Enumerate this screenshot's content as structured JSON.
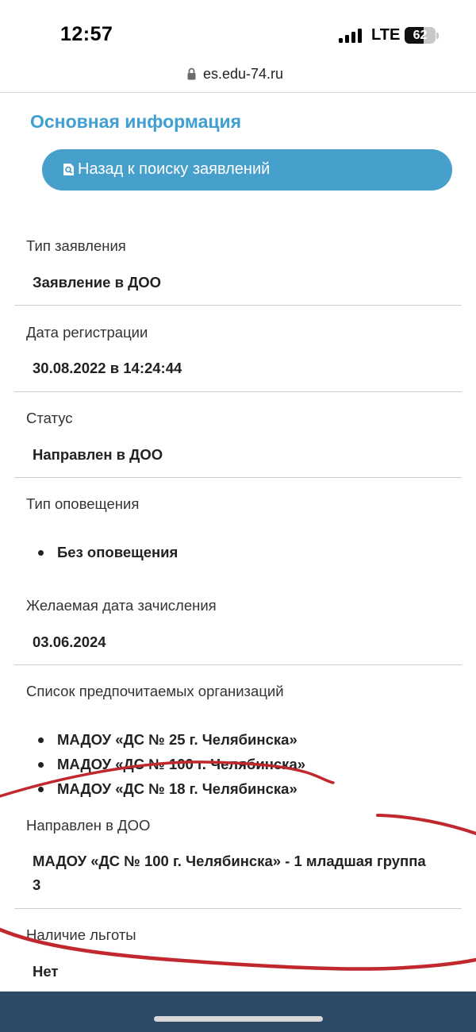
{
  "status_bar": {
    "time": "12:57",
    "network": "LTE",
    "battery": "62",
    "battery_level": 0.62
  },
  "browser": {
    "url": "es.edu-74.ru"
  },
  "page": {
    "section_title": "Основная информация",
    "back_button_label": "Назад к поиску заявлений"
  },
  "fields": {
    "application_type": {
      "label": "Тип заявления",
      "value": "Заявление в ДОО"
    },
    "registration_date": {
      "label": "Дата регистрации",
      "value": "30.08.2022 в 14:24:44"
    },
    "status": {
      "label": "Статус",
      "value": "Направлен в ДОО"
    },
    "notification_type": {
      "label": "Тип оповещения",
      "items": [
        "Без оповещения"
      ]
    },
    "desired_enrollment_date": {
      "label": "Желаемая дата зачисления",
      "value": "03.06.2024"
    },
    "preferred_organizations": {
      "label": "Список предпочитаемых организаций",
      "items": [
        "МАДОУ «ДС № 25 г. Челябинска»",
        "МАДОУ «ДС № 100 г. Челябинска»",
        "МАДОУ «ДС № 18 г. Челябинска»"
      ]
    },
    "assigned_doo": {
      "label": "Направлен в ДОО",
      "value_line1": "МАДОУ «ДС № 100 г. Челябинска» - 1 младшая группа",
      "value_line2": "3"
    },
    "benefit": {
      "label": "Наличие льготы",
      "value": "Нет"
    }
  },
  "colors": {
    "accent": "#3f9fd0",
    "button": "#479fcc",
    "footer": "#2d4a66",
    "ink": "#c0282d"
  }
}
